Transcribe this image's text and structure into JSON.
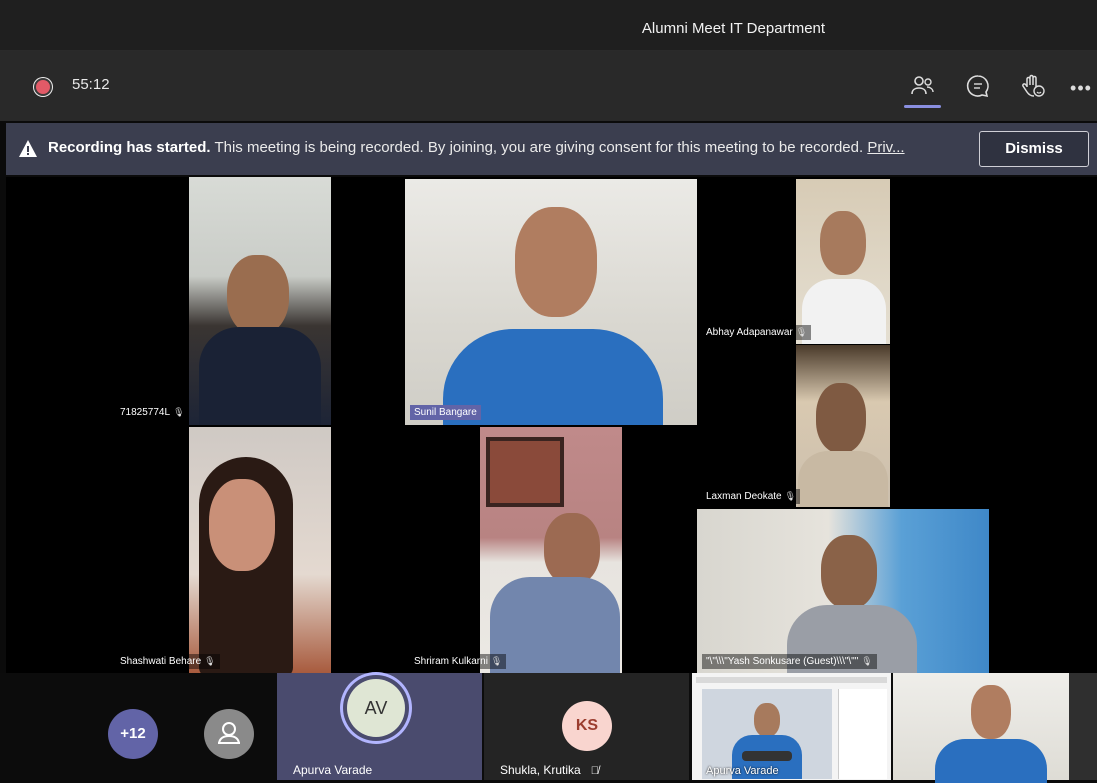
{
  "window": {
    "title": "Alumni Meet IT Department"
  },
  "toolbar": {
    "recording_indicator": "recording",
    "timer": "55:12",
    "icons": [
      "people-icon",
      "chat-icon",
      "raise-hand-icon",
      "more-icon"
    ],
    "more_label": "•••"
  },
  "banner": {
    "heading": "Recording has started.",
    "message": "This meeting is being recorded. By joining, you are giving consent for this meeting to be recorded.",
    "link": "Priv...",
    "dismiss": "Dismiss"
  },
  "participants": {
    "p1": "71825774L",
    "p2": "Sunil Bangare",
    "p3": "Abhay Adapanawar",
    "p4": "Laxman Deokate",
    "p5": "Shashwati Behare",
    "p6": "Shriram Kulkarni",
    "p7": "\"\\\"\\\\\\\"Yash Sonkusare (Guest)\\\\\\\"\\\"\""
  },
  "bottom": {
    "overflow_count": "+12",
    "av_initials": "AV",
    "av_name": "Apurva Varade",
    "ks_initials": "KS",
    "ks_name": "Shukla, Krutika",
    "share_overlay_name": "Apurva Varade"
  },
  "colors": {
    "accent": "#6264a7",
    "banner_bg": "#3b3e4f",
    "record": "#e25a67"
  }
}
